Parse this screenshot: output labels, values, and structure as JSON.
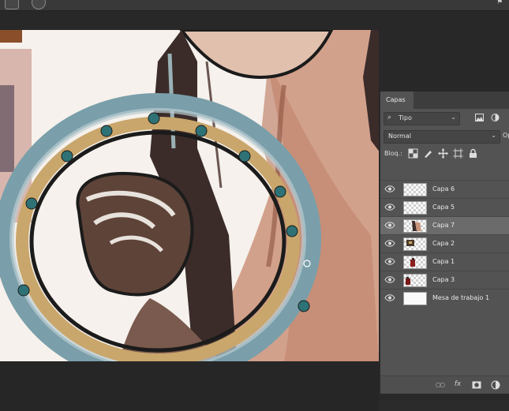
{
  "layers_panel": {
    "tab_title": "Capas",
    "kind_filter": "Tipo",
    "blend_mode": "Normal",
    "opacity_label_clipped": "Op",
    "lock_label": "Bloq.:",
    "layers": [
      {
        "name": "Capa 6",
        "visible": true,
        "selected": false,
        "thumb": "transparent"
      },
      {
        "name": "Capa 5",
        "visible": true,
        "selected": false,
        "thumb": "transparent"
      },
      {
        "name": "Capa 7",
        "visible": true,
        "selected": true,
        "thumb": "art"
      },
      {
        "name": "Capa 2",
        "visible": true,
        "selected": false,
        "thumb": "dark-art"
      },
      {
        "name": "Capa 1",
        "visible": true,
        "selected": false,
        "thumb": "red-art"
      },
      {
        "name": "Capa 3",
        "visible": true,
        "selected": false,
        "thumb": "red-art"
      },
      {
        "name": "Mesa de trabajo 1",
        "visible": true,
        "selected": false,
        "thumb": "white"
      }
    ],
    "footer_icons": [
      "link-icon",
      "fx-icon",
      "mask-icon",
      "adjustment-icon"
    ],
    "footer_fx": "fx"
  },
  "colors": {
    "panel_bg": "#535353",
    "selected_row": "#6b6b6b",
    "ring_blue": "#6e95a1",
    "ring_gold": "#c9a66b",
    "skin": "#c9957d",
    "hair": "#3b2c2a"
  }
}
